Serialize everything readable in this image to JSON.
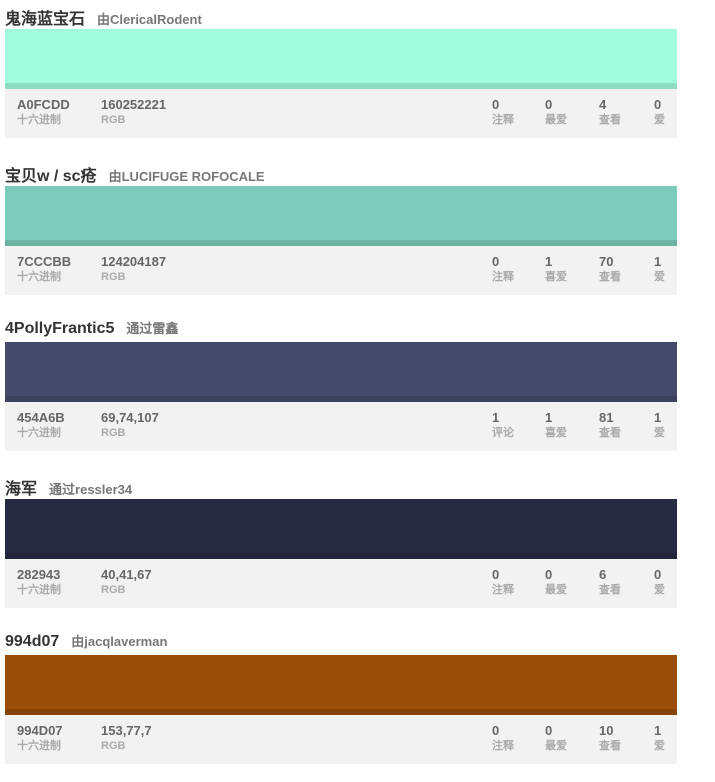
{
  "colors": [
    {
      "title": "鬼海蓝宝石",
      "by": "由",
      "author": "ClericalRodent",
      "color": "#A0FCDD",
      "hex": "A0FCDD",
      "hex_label": "十六进制",
      "rgb": "160252221",
      "rgb_label": "RGB",
      "comments": "0",
      "comments_label": "注释",
      "favorites": "0",
      "favorites_label": "最爱",
      "views": "4",
      "views_label": "查看",
      "loves": "0",
      "loves_label": "爱"
    },
    {
      "title": "宝贝w / sc疮",
      "by": "由",
      "author": "LUCIFUGE ROFOCALE",
      "color": "#7CCCBB",
      "hex": "7CCCBB",
      "hex_label": "十六进制",
      "rgb": "124204187",
      "rgb_label": "RGB",
      "comments": "0",
      "comments_label": "注释",
      "favorites": "1",
      "favorites_label": "喜爱",
      "views": "70",
      "views_label": "查看",
      "loves": "1",
      "loves_label": "爱"
    },
    {
      "title": "4PollyFrantic5",
      "by": "通过",
      "author": "雷鑫",
      "color": "#454A6B",
      "hex": "454A6B",
      "hex_label": "十六进制",
      "rgb": "69,74,107",
      "rgb_label": "RGB",
      "comments": "1",
      "comments_label": "评论",
      "favorites": "1",
      "favorites_label": "喜爱",
      "views": "81",
      "views_label": "查看",
      "loves": "1",
      "loves_label": "爱"
    },
    {
      "title": "海军",
      "by": "通过",
      "author": "ressler34",
      "color": "#282943",
      "hex": "282943",
      "hex_label": "十六进制",
      "rgb": "40,41,67",
      "rgb_label": "RGB",
      "comments": "0",
      "comments_label": "注释",
      "favorites": "0",
      "favorites_label": "最爱",
      "views": "6",
      "views_label": "查看",
      "loves": "0",
      "loves_label": "爱"
    },
    {
      "title": "994d07",
      "by": "由",
      "author": "jacqlaverman",
      "color": "#994D07",
      "hex": "994D07",
      "hex_label": "十六进制",
      "rgb": "153,77,7",
      "rgb_label": "RGB",
      "comments": "0",
      "comments_label": "注释",
      "favorites": "0",
      "favorites_label": "最爱",
      "views": "10",
      "views_label": "查看",
      "loves": "1",
      "loves_label": "爱"
    }
  ]
}
